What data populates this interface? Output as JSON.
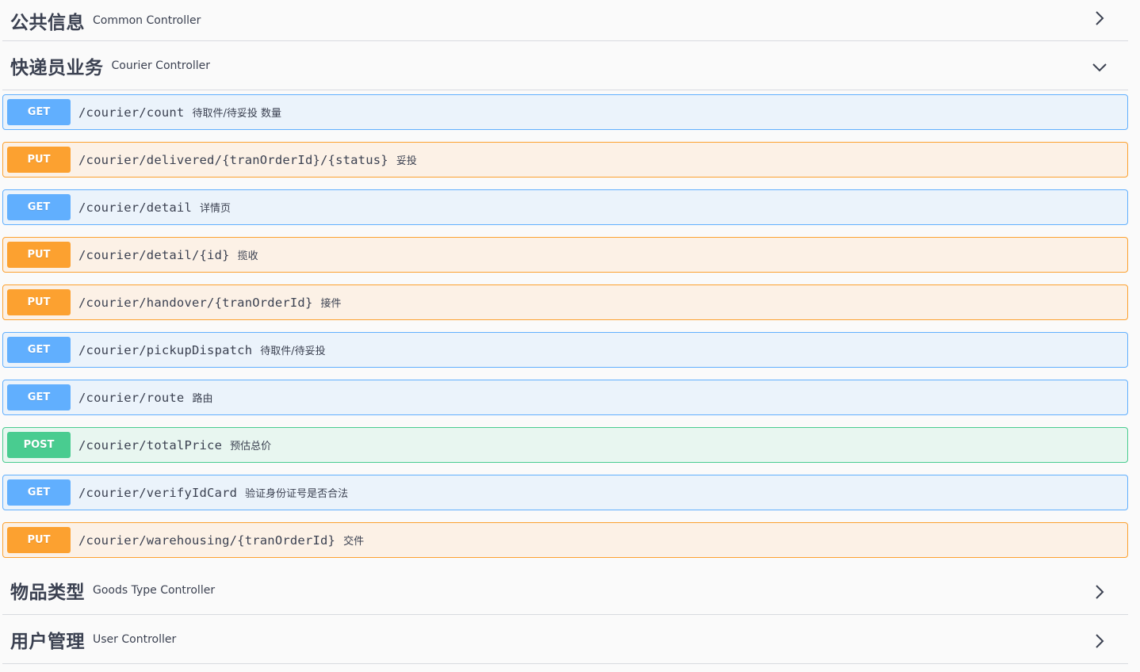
{
  "tags": [
    {
      "title": "公共信息",
      "desc": "Common Controller",
      "state": "collapsed"
    },
    {
      "title": "快递员业务",
      "desc": "Courier Controller",
      "state": "expanded"
    },
    {
      "title": "物品类型",
      "desc": "Goods Type Controller",
      "state": "collapsed"
    },
    {
      "title": "用户管理",
      "desc": "User Controller",
      "state": "collapsed"
    }
  ],
  "operations": [
    {
      "method": "GET",
      "path": "/courier/count",
      "summary": "待取件/待妥投 数量"
    },
    {
      "method": "PUT",
      "path": "/courier/delivered/{tranOrderId}/{status}",
      "summary": "妥投"
    },
    {
      "method": "GET",
      "path": "/courier/detail",
      "summary": "详情页"
    },
    {
      "method": "PUT",
      "path": "/courier/detail/{id}",
      "summary": "揽收"
    },
    {
      "method": "PUT",
      "path": "/courier/handover/{tranOrderId}",
      "summary": "接件"
    },
    {
      "method": "GET",
      "path": "/courier/pickupDispatch",
      "summary": "待取件/待妥投"
    },
    {
      "method": "GET",
      "path": "/courier/route",
      "summary": "路由"
    },
    {
      "method": "POST",
      "path": "/courier/totalPrice",
      "summary": "预估总价"
    },
    {
      "method": "GET",
      "path": "/courier/verifyIdCard",
      "summary": "验证身份证号是否合法"
    },
    {
      "method": "PUT",
      "path": "/courier/warehousing/{tranOrderId}",
      "summary": "交件"
    }
  ],
  "colors": {
    "get": "#61affe",
    "put": "#fca130",
    "post": "#49cc90",
    "text": "#3b4151"
  }
}
